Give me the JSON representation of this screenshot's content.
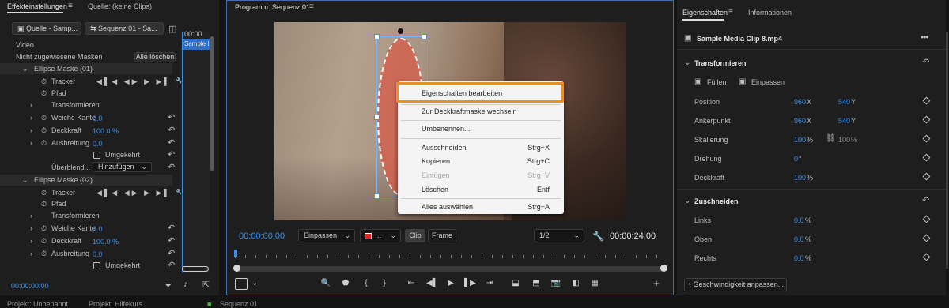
{
  "effects_panel": {
    "tab_effects": "Effekteinstellungen",
    "tab_source": "Quelle: (keine Clips)",
    "source_tab": "Quelle - Samp...",
    "sequence_tab": "Sequenz 01 - Sa...",
    "timeline_time": "00:00",
    "clip_label": "Sample I",
    "video_label": "Video",
    "masks_label": "Nicht zugewiesene Masken",
    "clear_all": "Alle löschen",
    "mask1": "Ellipse Maske (01)",
    "tracker": "Tracker",
    "path": "Pfad",
    "transform": "Transformieren",
    "feather": "Weiche Kante",
    "feather_value": "0.0",
    "opacity": "Deckkraft",
    "opacity_value": "100.0 %",
    "expansion": "Ausbreitung",
    "expansion_value": "0.0",
    "inverted": "Umgekehrt",
    "blend": "Überblend...",
    "blend_value": "Hinzufügen",
    "mask2": "Ellipse Maske (02)",
    "timecode": "00:00:00:00"
  },
  "program_monitor": {
    "title": "Programm: Sequenz 01",
    "timecode_left": "00:00:00:00",
    "fit": "Einpassen",
    "clip_btn": "Clip",
    "frame_btn": "Frame",
    "resolution": "1/2",
    "timecode_right": "00:00:24:00"
  },
  "context_menu": {
    "items": [
      {
        "label": "Eigenschaften bearbeiten",
        "shortcut": "",
        "disabled": false
      },
      {
        "label": "Zur Deckkraftmaske wechseln",
        "shortcut": "",
        "disabled": false
      },
      {
        "label": "Umbenennen...",
        "shortcut": "",
        "disabled": false
      },
      {
        "label": "Ausschneiden",
        "shortcut": "Strg+X",
        "disabled": false
      },
      {
        "label": "Kopieren",
        "shortcut": "Strg+C",
        "disabled": false
      },
      {
        "label": "Einfügen",
        "shortcut": "Strg+V",
        "disabled": true
      },
      {
        "label": "Löschen",
        "shortcut": "Entf",
        "disabled": false
      },
      {
        "label": "Alles auswählen",
        "shortcut": "Strg+A",
        "disabled": false
      }
    ]
  },
  "properties_panel": {
    "tab_properties": "Eigenschaften",
    "tab_info": "Informationen",
    "clip_name": "Sample Media Clip 8.mp4",
    "transform_header": "Transformieren",
    "fill": "Füllen",
    "fit": "Einpassen",
    "position_label": "Position",
    "position_x": "960",
    "position_y": "540",
    "anchor_label": "Ankerpunkt",
    "anchor_x": "960",
    "anchor_y": "540",
    "axis_x": "X",
    "axis_y": "Y",
    "scale_label": "Skalierung",
    "scale_value": "100",
    "scale_value2": "100",
    "percent": "%",
    "rotation_label": "Drehung",
    "rotation_value": "0",
    "degree": "°",
    "opacity_label": "Deckkraft",
    "opacity_value": "100",
    "crop_header": "Zuschneiden",
    "left_label": "Links",
    "left_value": "0.0",
    "top_label": "Oben",
    "top_value": "0.0",
    "right_label": "Rechts",
    "right_value": "0.0",
    "speed_btn": "Geschwindigkeit anpassen..."
  },
  "bottom_tabs": {
    "tab1": "Projekt: Unbenannt",
    "tab2": "Projekt: Hilfekurs",
    "tab3": "Sequenz 01"
  },
  "colors": {
    "accent_orange": "#e8902a",
    "value_blue": "#3b8eea",
    "panel_bg": "#1e1e1e",
    "menu_bg": "#f4f4f4"
  }
}
